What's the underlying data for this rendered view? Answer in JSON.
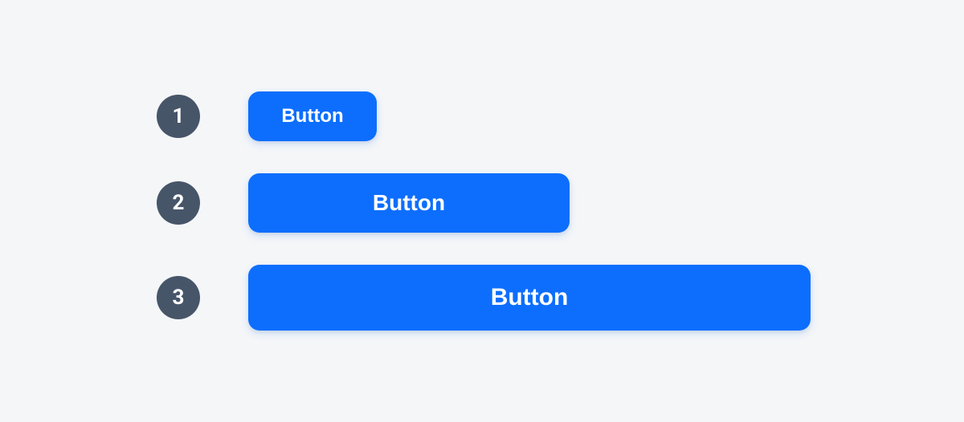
{
  "rows": [
    {
      "badge": "1",
      "label": "Button"
    },
    {
      "badge": "2",
      "label": "Button"
    },
    {
      "badge": "3",
      "label": "Button"
    }
  ],
  "colors": {
    "button_bg": "#0d6efd",
    "badge_bg": "#475569",
    "page_bg": "#f4f6f8"
  }
}
